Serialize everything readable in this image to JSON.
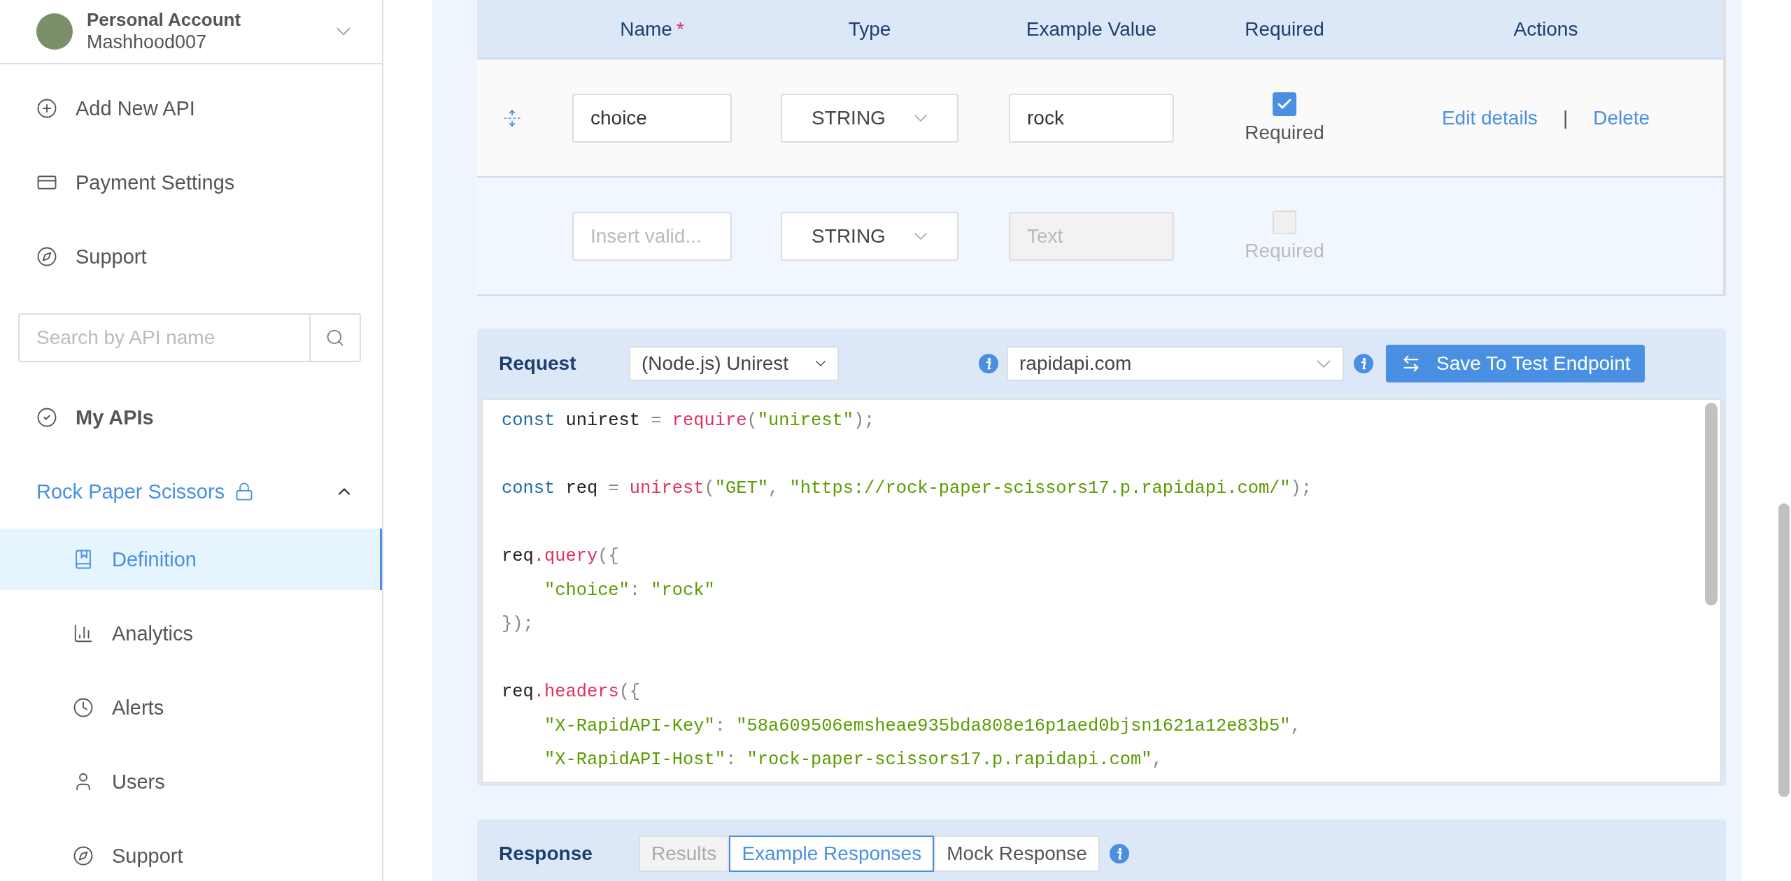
{
  "sidebar": {
    "account": {
      "title": "Personal Account",
      "username": "Mashhood007",
      "expanded": false
    },
    "nav_items": [
      {
        "label": "Add New API"
      },
      {
        "label": "Payment Settings"
      },
      {
        "label": "Support"
      }
    ],
    "search": {
      "placeholder": "Search by API name"
    },
    "my_apis": {
      "label": "My APIs"
    },
    "api": {
      "name": "Rock Paper Scissors",
      "locked": true,
      "expanded": true,
      "children": [
        {
          "label": "Definition",
          "selected": true
        },
        {
          "label": "Analytics",
          "selected": false
        },
        {
          "label": "Alerts",
          "selected": false
        },
        {
          "label": "Users",
          "selected": false
        },
        {
          "label": "Support",
          "selected": false
        }
      ]
    }
  },
  "parameters": {
    "columns": [
      {
        "label": "Name",
        "marker": "*"
      },
      {
        "label": "Type"
      },
      {
        "label": "Example Value"
      },
      {
        "label": "Required"
      },
      {
        "label": "Actions"
      }
    ],
    "rows": [
      {
        "kind": "param",
        "name": "choice",
        "type": "STRING",
        "example": "rock",
        "required": true,
        "disabled": false,
        "required_label": "Required",
        "actions": [
          "Edit details",
          "Delete"
        ],
        "separator": "|"
      },
      {
        "kind": "new",
        "name_placeholder": "Insert valid...",
        "type": "STRING",
        "example_placeholder": "Text",
        "required": false,
        "disabled": true,
        "required_label": "Required"
      }
    ]
  },
  "request": {
    "title": "Request",
    "language": "(Node.js) Unirest",
    "host": "rapidapi.com",
    "button": "Save To Test Endpoint",
    "code_lines": [
      {
        "gap_before": false,
        "tokens": [
          {
            "kind": "keyword",
            "text": "const"
          },
          {
            "kind": "plain",
            "text": " unirest "
          },
          {
            "kind": "punct",
            "text": "= "
          },
          {
            "kind": "func",
            "text": "require"
          },
          {
            "kind": "punct",
            "text": "("
          },
          {
            "kind": "string",
            "text": "\"unirest\""
          },
          {
            "kind": "punct",
            "text": ");"
          }
        ]
      },
      {
        "gap_before": true,
        "tokens": [
          {
            "kind": "keyword",
            "text": "const"
          },
          {
            "kind": "plain",
            "text": " req "
          },
          {
            "kind": "punct",
            "text": "= "
          },
          {
            "kind": "func",
            "text": "unirest"
          },
          {
            "kind": "punct",
            "text": "("
          },
          {
            "kind": "string",
            "text": "\"GET\""
          },
          {
            "kind": "punct",
            "text": ", "
          },
          {
            "kind": "string",
            "text": "\"https://rock-paper-scissors17.p.rapidapi.com/\""
          },
          {
            "kind": "punct",
            "text": ");"
          }
        ]
      },
      {
        "gap_before": true,
        "tokens": [
          {
            "kind": "plain",
            "text": "req"
          },
          {
            "kind": "func",
            "text": ".query"
          },
          {
            "kind": "punct",
            "text": "({"
          }
        ]
      },
      {
        "gap_before": false,
        "tokens": [
          {
            "kind": "string",
            "text": "    \"choice\""
          },
          {
            "kind": "punct",
            "text": ": "
          },
          {
            "kind": "string",
            "text": "\"rock\""
          }
        ]
      },
      {
        "gap_before": false,
        "tokens": [
          {
            "kind": "punct",
            "text": "});"
          }
        ]
      },
      {
        "gap_before": true,
        "tokens": [
          {
            "kind": "plain",
            "text": "req"
          },
          {
            "kind": "func",
            "text": ".headers"
          },
          {
            "kind": "punct",
            "text": "({"
          }
        ]
      },
      {
        "gap_before": false,
        "tokens": [
          {
            "kind": "string",
            "text": "    \"X-RapidAPI-Key\""
          },
          {
            "kind": "punct",
            "text": ": "
          },
          {
            "kind": "string",
            "text": "\"58a609506emsheae935bda808e16p1aed0bjsn1621a12e83b5\""
          },
          {
            "kind": "punct",
            "text": ","
          }
        ]
      },
      {
        "gap_before": false,
        "tokens": [
          {
            "kind": "string",
            "text": "    \"X-RapidAPI-Host\""
          },
          {
            "kind": "punct",
            "text": ": "
          },
          {
            "kind": "string",
            "text": "\"rock-paper-scissors17.p.rapidapi.com\""
          },
          {
            "kind": "punct",
            "text": ","
          }
        ]
      }
    ]
  },
  "response": {
    "title": "Response",
    "tabs": [
      {
        "label": "Results",
        "selected": false,
        "disabled": true
      },
      {
        "label": "Example Responses",
        "selected": true,
        "disabled": false
      },
      {
        "label": "Mock Response",
        "selected": false,
        "disabled": false
      }
    ]
  }
}
